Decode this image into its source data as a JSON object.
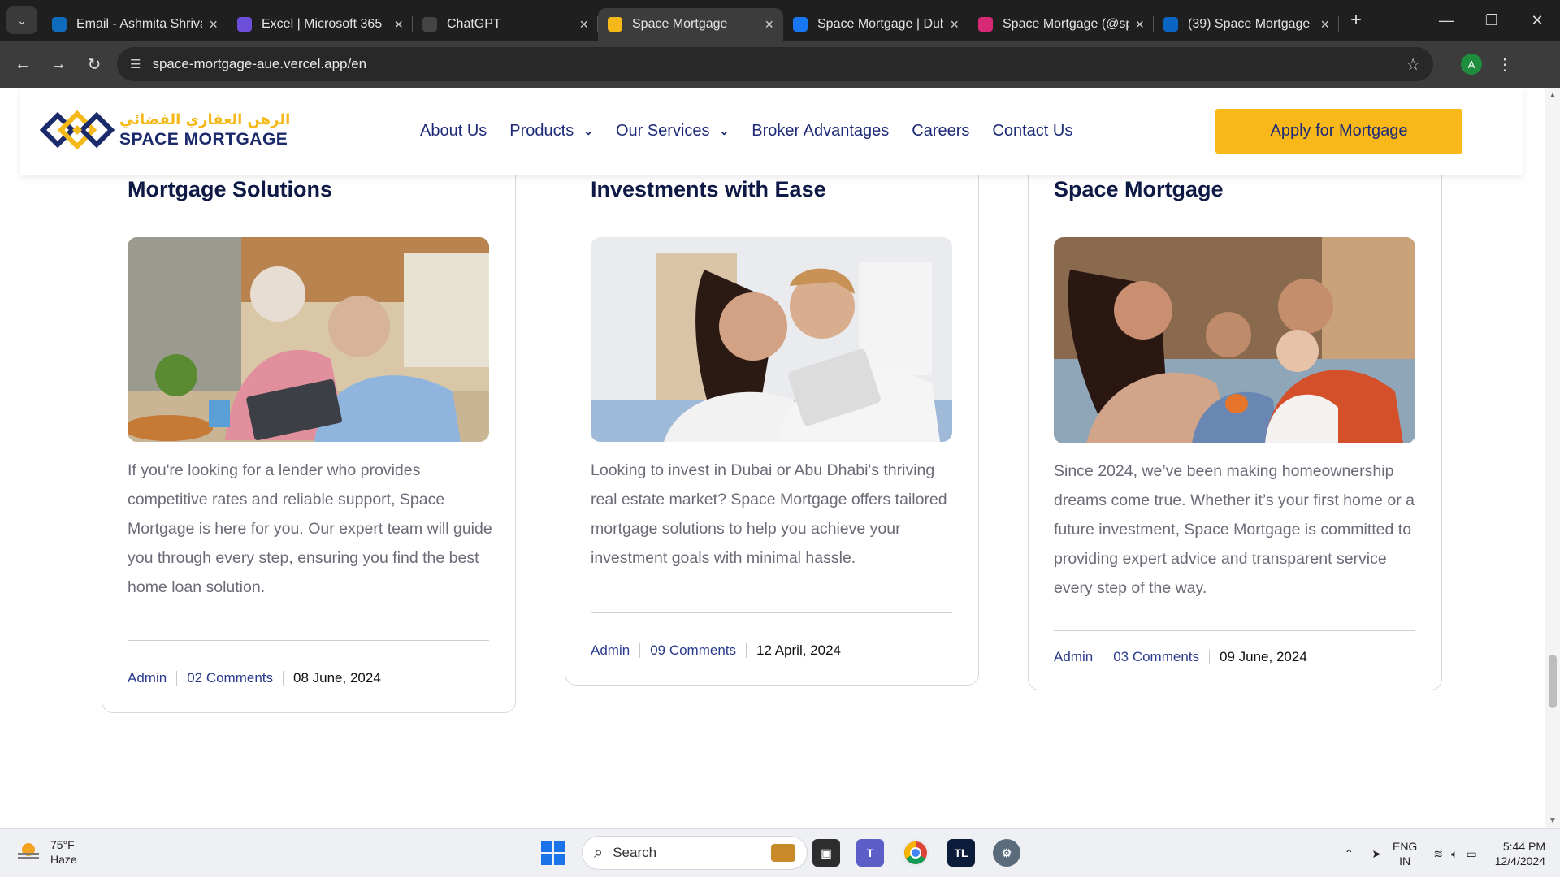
{
  "browser": {
    "tabs": [
      {
        "title": "Email - Ashmita Shrivastava",
        "icon": "outlook-icon",
        "color": "#0f6cbd",
        "active": false
      },
      {
        "title": "Excel | Microsoft 365",
        "icon": "copilot-icon",
        "color": "#6b4fd8",
        "active": false
      },
      {
        "title": "ChatGPT",
        "icon": "chatgpt-icon",
        "color": "#444444",
        "active": false
      },
      {
        "title": "Space Mortgage",
        "icon": "space-mortgage-icon",
        "color": "#f5b819",
        "active": true
      },
      {
        "title": "Space Mortgage | Dubai",
        "icon": "facebook-icon",
        "color": "#1877f2",
        "active": false
      },
      {
        "title": "Space Mortgage (@space",
        "icon": "instagram-icon",
        "color": "#d62976",
        "active": false
      },
      {
        "title": "(39) Space Mortgage",
        "icon": "linkedin-icon",
        "color": "#0a66c2",
        "active": false
      }
    ],
    "url": "space-mortgage-aue.vercel.app/en",
    "profile_initial": "A"
  },
  "site": {
    "logo_arabic": "الرهن العقاري الفضائي",
    "logo_english": "SPACE MORTGAGE",
    "nav": [
      {
        "label": "About Us",
        "dropdown": false
      },
      {
        "label": "Products",
        "dropdown": true
      },
      {
        "label": "Our Services",
        "dropdown": true
      },
      {
        "label": "Broker Advantages",
        "dropdown": false
      },
      {
        "label": "Careers",
        "dropdown": false
      },
      {
        "label": "Contact Us",
        "dropdown": false
      }
    ],
    "cta": "Apply for Mortgage",
    "colors": {
      "navy": "#1d2a78",
      "gold": "#f9b819"
    }
  },
  "cards": [
    {
      "title": "Mortgage Solutions",
      "body": "If you're looking for a lender who provides competitive rates and reliable support, Space Mortgage is here for you. Our expert team will guide you through every step, ensuring you find the best home loan solution.",
      "author": "Admin",
      "comments": "02 Comments",
      "date": "08 June, 2024"
    },
    {
      "title": "Investments with Ease",
      "body": "Looking to invest in Dubai or Abu Dhabi's thriving real estate market? Space Mortgage offers tailored mortgage solutions to help you achieve your investment goals with minimal hassle.",
      "author": "Admin",
      "comments": "09 Comments",
      "date": "12 April, 2024"
    },
    {
      "title": "Space Mortgage",
      "body": "Since 2024, we’ve been making homeownership dreams come true. Whether it’s your first home or a future investment, Space Mortgage is committed to providing expert advice and transparent service every step of the way.",
      "author": "Admin",
      "comments": "03 Comments",
      "date": "09 June, 2024"
    }
  ],
  "taskbar": {
    "temp": "75°F",
    "condition": "Haze",
    "search_placeholder": "Search",
    "lang_top": "ENG",
    "lang_bottom": "IN",
    "time": "5:44 PM",
    "date": "12/4/2024"
  }
}
